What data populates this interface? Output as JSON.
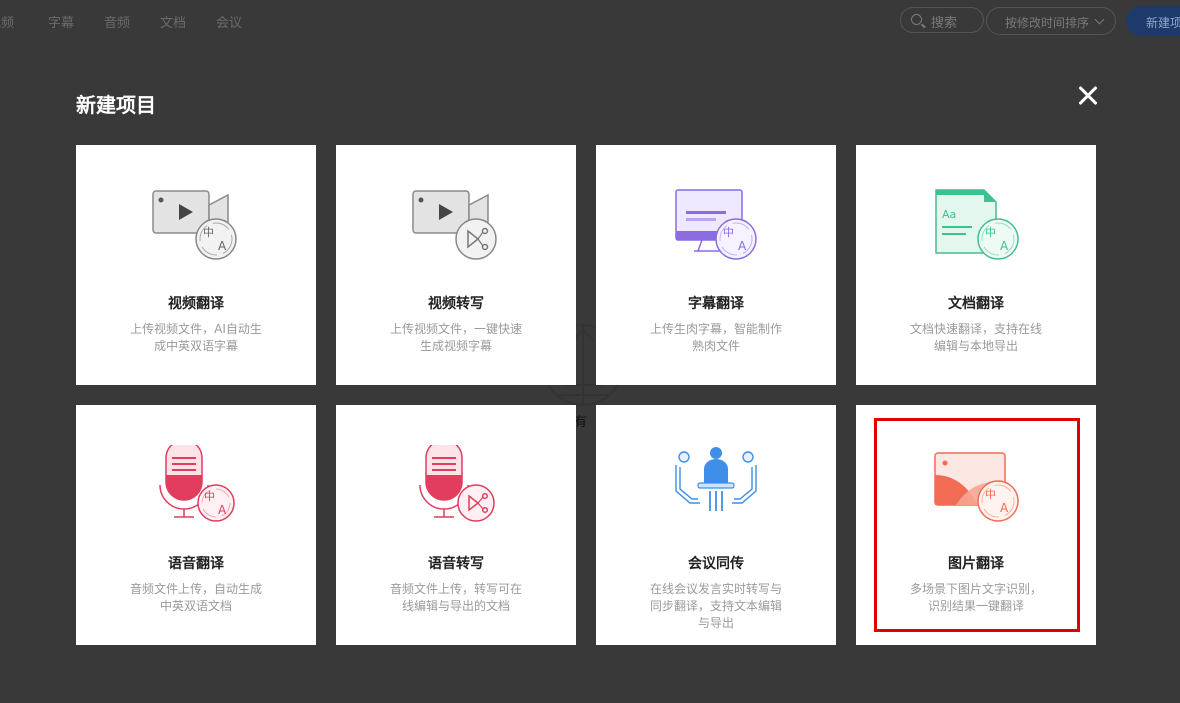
{
  "topnav": {
    "items": [
      "视频",
      "字幕",
      "音频",
      "文档",
      "会议"
    ]
  },
  "toolbar": {
    "search_label": "搜索",
    "sort_label": "按修改时间排序",
    "new_label": "新建项目"
  },
  "watermark": {
    "text": "有"
  },
  "modal": {
    "title": "新建项目",
    "cards": [
      {
        "title": "视频翻译",
        "desc": "上传视频文件，AI自动生成中英双语字幕",
        "icon": "video-translate-icon"
      },
      {
        "title": "视频转写",
        "desc": "上传视频文件，一键快速生成视频字幕",
        "icon": "video-transcribe-icon"
      },
      {
        "title": "字幕翻译",
        "desc": "上传生肉字幕，智能制作熟肉文件",
        "icon": "subtitle-translate-icon"
      },
      {
        "title": "文档翻译",
        "desc": "文档快速翻译，支持在线编辑与本地导出",
        "icon": "document-translate-icon"
      },
      {
        "title": "语音翻译",
        "desc": "音频文件上传，自动生成中英双语文档",
        "icon": "voice-translate-icon"
      },
      {
        "title": "语音转写",
        "desc": "音频文件上传，转写可在线编辑与导出的文档",
        "icon": "voice-transcribe-icon"
      },
      {
        "title": "会议同传",
        "desc": "在线会议发言实时转写与同步翻译，支持文本编辑与导出",
        "icon": "meeting-interpret-icon"
      },
      {
        "title": "图片翻译",
        "desc": "多场景下图片文字识别，识别结果一键翻译",
        "icon": "image-translate-icon"
      }
    ]
  },
  "colors": {
    "overlay": "#393939",
    "highlight": "#e00000",
    "video": "#8a8a8a",
    "subtitle": "#8b6ce0",
    "document": "#3fc08f",
    "voice": "#e23c5e",
    "meeting": "#3f8fe8",
    "image": "#f26b55"
  }
}
